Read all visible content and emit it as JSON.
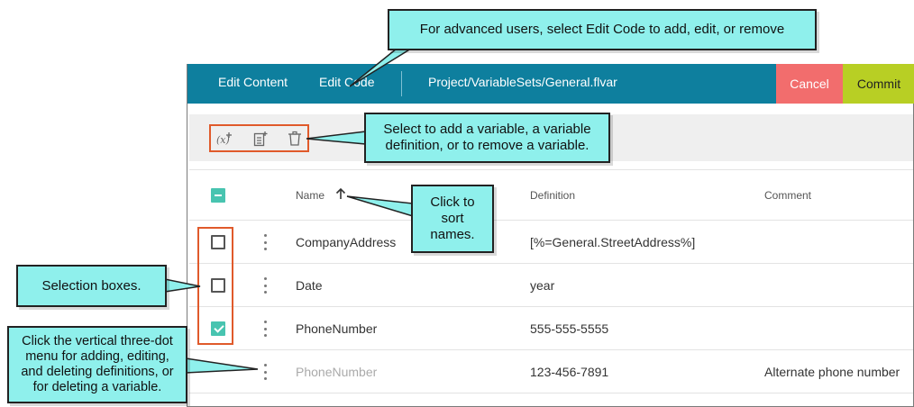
{
  "topbar": {
    "tabs": [
      {
        "label": "Edit Content",
        "active": true
      },
      {
        "label": "Edit Code",
        "active": false
      }
    ],
    "path": "Project/VariableSets/General.flvar",
    "cancel_label": "Cancel",
    "commit_label": "Commit"
  },
  "toolbar": {
    "tools": [
      {
        "icon": "add-variable-icon"
      },
      {
        "icon": "add-definition-icon"
      },
      {
        "icon": "trash-icon"
      }
    ]
  },
  "table": {
    "columns": [
      "Name",
      "Definition",
      "Comment"
    ],
    "sort_icon": "arrow-up-icon",
    "header_checkbox": "mixed",
    "rows": [
      {
        "name": "CompanyAddress",
        "definition": "[%=General.StreetAddress%]",
        "comment": "",
        "checked": false
      },
      {
        "name": "Date",
        "definition": "year",
        "comment": "",
        "checked": false
      },
      {
        "name": "PhoneNumber",
        "definition": "555-555-5555",
        "comment": "",
        "checked": true
      },
      {
        "name": "PhoneNumber",
        "definition": "123-456-7891",
        "comment": "Alternate phone number",
        "checked": null
      }
    ]
  },
  "callouts": {
    "edit_code": "For advanced users, select Edit Code to add, edit, or remove",
    "tools": [
      "Select to add a variable, a variable",
      "definition, or to remove a variable."
    ],
    "sort": [
      "Click to",
      "sort",
      "names."
    ],
    "selection": "Selection boxes.",
    "dots_menu": [
      "Click the vertical three-dot",
      "menu for adding, editing,",
      "and deleting definitions, or",
      "for deleting a variable."
    ]
  },
  "colors": {
    "topbar": "#0e7f9e",
    "cancel": "#f26d6d",
    "commit": "#b8cf24",
    "checkbox_checked": "#48c4b0",
    "highlight_outline": "#e05a2b",
    "callout_fill": "#8ff0ec"
  }
}
